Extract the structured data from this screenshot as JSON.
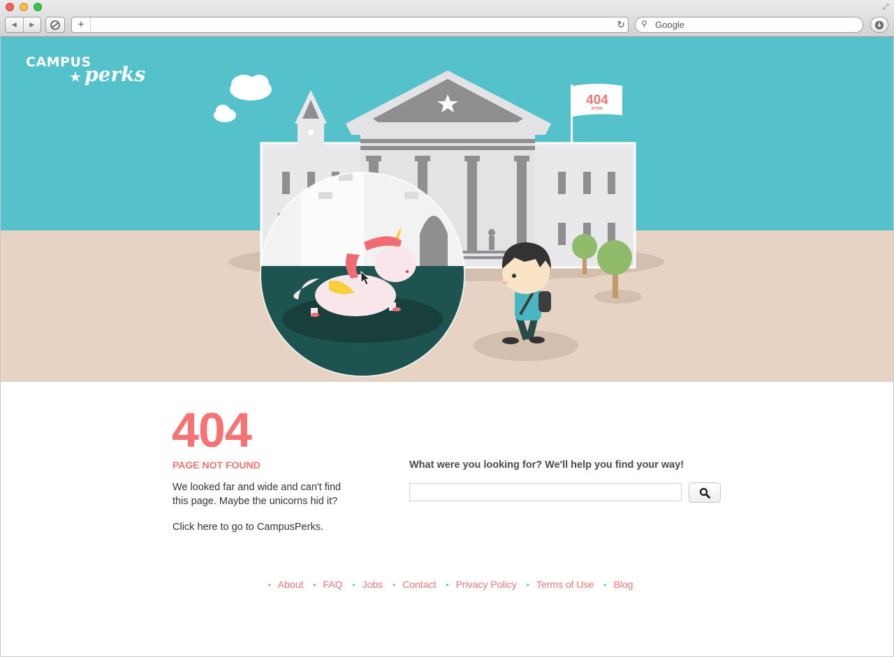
{
  "browser": {
    "search_placeholder": "Google",
    "colors": {
      "chrome_top": "#ebebeb",
      "chrome_bottom": "#d2d2d2"
    }
  },
  "hero": {
    "logo_campus": "CAMPUS",
    "logo_perks": "perks",
    "flag_code": "404",
    "flag_sub": "error",
    "colors": {
      "sky": "#55c1cb",
      "ground": "#e6d3c4",
      "accent": "#f67373"
    }
  },
  "main": {
    "error_code": "404",
    "heading": "PAGE NOT FOUND",
    "description": "We looked far and wide and can't find this page. Maybe the unicorns hid it?",
    "home_link": "Click here to go to CampusPerks.",
    "help_text": "What were you looking for? We'll help you find your way!",
    "search_placeholder": ""
  },
  "footer": {
    "links": [
      {
        "label": "About"
      },
      {
        "label": "FAQ"
      },
      {
        "label": "Jobs"
      },
      {
        "label": "Contact"
      },
      {
        "label": "Privacy Policy"
      },
      {
        "label": "Terms of Use"
      },
      {
        "label": "Blog"
      }
    ]
  }
}
